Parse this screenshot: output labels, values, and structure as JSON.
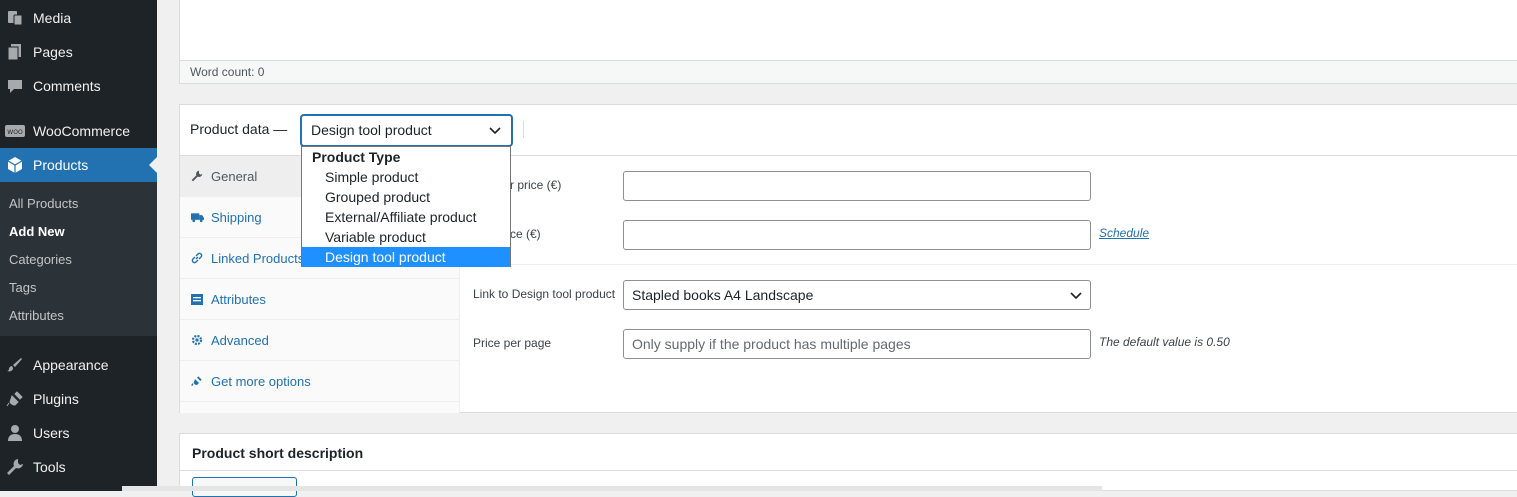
{
  "sidebar": {
    "menu": [
      {
        "label": "Media",
        "icon": "media-icon"
      },
      {
        "label": "Pages",
        "icon": "pages-icon"
      },
      {
        "label": "Comments",
        "icon": "comments-icon"
      },
      {
        "label": "WooCommerce",
        "icon": "woocommerce-icon"
      },
      {
        "label": "Products",
        "icon": "products-box-icon"
      },
      {
        "label": "Appearance",
        "icon": "paintbrush-icon"
      },
      {
        "label": "Plugins",
        "icon": "plugin-icon"
      },
      {
        "label": "Users",
        "icon": "user-icon"
      },
      {
        "label": "Tools",
        "icon": "wrench-icon"
      }
    ],
    "submenu": [
      "All Products",
      "Add New",
      "Categories",
      "Tags",
      "Attributes"
    ],
    "woo_badge": "WOO"
  },
  "editor": {
    "word_count": "Word count: 0"
  },
  "product_data": {
    "title": "Product data —",
    "selected_type": "Design tool product",
    "tabs": [
      {
        "label": "General",
        "icon": "wrench-icon"
      },
      {
        "label": "Shipping",
        "icon": "truck-icon"
      },
      {
        "label": "Linked Products",
        "icon": "link-icon"
      },
      {
        "label": "Attributes",
        "icon": "list-icon"
      },
      {
        "label": "Advanced",
        "icon": "gear-icon"
      },
      {
        "label": "Get more options",
        "icon": "plugin-icon"
      }
    ],
    "fields": {
      "regular_price_label": "r price (€)",
      "sale_price_label": "ce (€)",
      "schedule_link": "Schedule",
      "design_tool_label": "Link to Design tool product",
      "design_tool_value": "Stapled books A4 Landscape",
      "price_per_page_label": "Price per page",
      "price_per_page_placeholder": "Only supply if the product has multiple pages",
      "price_per_page_hint": "The default value is 0.50"
    },
    "dropdown": {
      "group_label": "Product Type",
      "options": [
        "Simple product",
        "Grouped product",
        "External/Affiliate product",
        "Variable product",
        "Design tool product"
      ],
      "selected": "Design tool product"
    }
  },
  "short_description": {
    "title": "Product short description"
  },
  "colors": {
    "accent": "#2271b1",
    "sidebar_bg": "#1d2327",
    "highlight": "#1e90ff"
  }
}
